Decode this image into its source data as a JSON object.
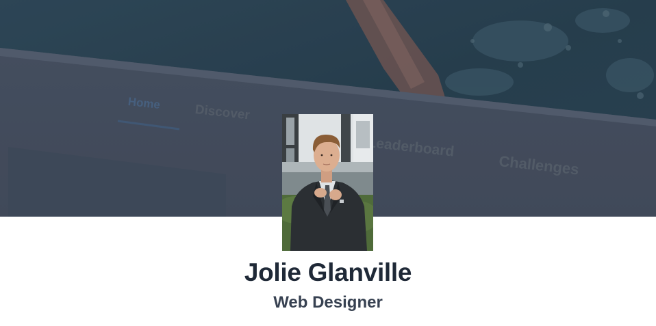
{
  "cover": {
    "tabs": [
      {
        "label": "Home",
        "active": true
      },
      {
        "label": "Discover",
        "active": false
      },
      {
        "label": "Leaderboard",
        "active": false
      },
      {
        "label": "Challenges",
        "active": false
      }
    ]
  },
  "profile": {
    "name": "Jolie Glanville",
    "role": "Web Designer"
  },
  "colors": {
    "name_text": "#1f2937",
    "role_text": "#374151",
    "banner_teal": "#2c3e4c",
    "banner_overlay": "#4a5464"
  }
}
